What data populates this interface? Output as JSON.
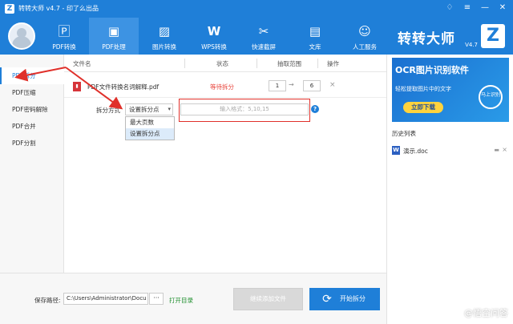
{
  "app": {
    "logo_letter": "Z",
    "title": "转转大师 v4.7 - 印了么出品"
  },
  "window_controls": {
    "skin": "♢",
    "menu": "≡",
    "minimize": "—",
    "close": "✕"
  },
  "nav": [
    {
      "label": "PDF转换",
      "icon": "pdf-icon",
      "glyph": "🄿"
    },
    {
      "label": "PDF处理",
      "icon": "pdf-process-icon",
      "glyph": "▣"
    },
    {
      "label": "图片转换",
      "icon": "image-icon",
      "glyph": "▨"
    },
    {
      "label": "WPS转换",
      "icon": "wps-icon",
      "glyph": "W"
    },
    {
      "label": "快速截屏",
      "icon": "scissors-icon",
      "glyph": "✂"
    },
    {
      "label": "文库",
      "icon": "library-icon",
      "glyph": "▤"
    },
    {
      "label": "人工服务",
      "icon": "support-icon",
      "glyph": "☺"
    }
  ],
  "brand": {
    "name": "转转大师",
    "letter": "Z",
    "version": "V4.7"
  },
  "sidebar": {
    "items": [
      {
        "label": "PDF拆分",
        "active": true
      },
      {
        "label": "PDF压缩",
        "active": false
      },
      {
        "label": "PDF密码解除",
        "active": false
      },
      {
        "label": "PDF合并",
        "active": false
      },
      {
        "label": "PDF分割",
        "active": false
      }
    ]
  },
  "table": {
    "headers": {
      "name": "文件名",
      "status": "状态",
      "range": "抽取范围",
      "action": "操作"
    },
    "file": {
      "name": "PDF文件转换名词解释.pdf",
      "status": "等待拆分",
      "range_from": "1",
      "range_arrow": "→",
      "range_to": "6",
      "delete": "×"
    }
  },
  "split": {
    "label": "拆分方式",
    "selected": "设置拆分点",
    "options": [
      "最大页数",
      "设置拆分点"
    ],
    "format_placeholder": "输入格式：5,10,15",
    "help": "?"
  },
  "ad": {
    "title": "OCR图片识别软件",
    "subtitle": "轻松提取图片中的文字",
    "button": "立即下载",
    "badge": "马上识别"
  },
  "history": {
    "title": "历史列表",
    "items": [
      {
        "name": "演示.doc",
        "icon": "word-icon"
      }
    ]
  },
  "bottom": {
    "save_label": "保存路径:",
    "save_path": "C:\\Users\\Administrator\\Docu",
    "browse": "···",
    "open_dir": "打开目录",
    "continue_btn": "继续添加文件",
    "start_btn": "开始拆分"
  },
  "watermark": "@悟空问答",
  "colors": {
    "brand_blue": "#1f7fd8",
    "status_red": "#e8453c",
    "open_dir_green": "#1f8f2e",
    "annotation_red": "#e0302a"
  }
}
